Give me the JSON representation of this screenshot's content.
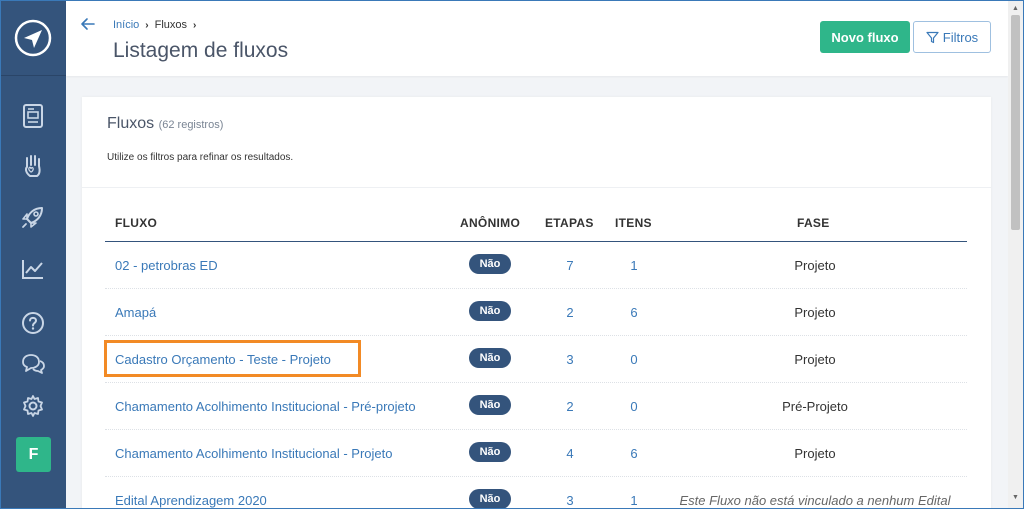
{
  "breadcrumb": {
    "home": "Início",
    "current": "Fluxos"
  },
  "page_title": "Listagem de fluxos",
  "buttons": {
    "new_flow": "Novo fluxo",
    "filters": "Filtros"
  },
  "sidebar": {
    "avatar_letter": "F"
  },
  "card": {
    "title": "Fluxos",
    "count": "(62 registros)",
    "hint": "Utilize os filtros para refinar os resultados."
  },
  "table": {
    "headers": {
      "fluxo": "FLUXO",
      "anonimo": "ANÔNIMO",
      "etapas": "ETAPAS",
      "itens": "ITENS",
      "fase": "FASE"
    },
    "rows": [
      {
        "name": "02 - petrobras ED",
        "anon": "Não",
        "etapas": "7",
        "itens": "1",
        "fase": "Projeto"
      },
      {
        "name": "Amapá",
        "anon": "Não",
        "etapas": "2",
        "itens": "6",
        "fase": "Projeto"
      },
      {
        "name": "Cadastro Orçamento - Teste - Projeto",
        "anon": "Não",
        "etapas": "3",
        "itens": "0",
        "fase": "Projeto"
      },
      {
        "name": "Chamamento Acolhimento Institucional - Pré-projeto",
        "anon": "Não",
        "etapas": "2",
        "itens": "0",
        "fase": "Pré-Projeto"
      },
      {
        "name": "Chamamento Acolhimento Institucional - Projeto",
        "anon": "Não",
        "etapas": "4",
        "itens": "6",
        "fase": "Projeto"
      },
      {
        "name": "Edital Aprendizagem 2020",
        "anon": "Não",
        "etapas": "3",
        "itens": "1",
        "fase": "Este Fluxo não está vinculado a nenhum Edital"
      }
    ]
  },
  "colors": {
    "sidebar": "#34547c",
    "accent": "#3a79b8",
    "primary_button": "#2fb68a",
    "highlight": "#f28a25"
  }
}
